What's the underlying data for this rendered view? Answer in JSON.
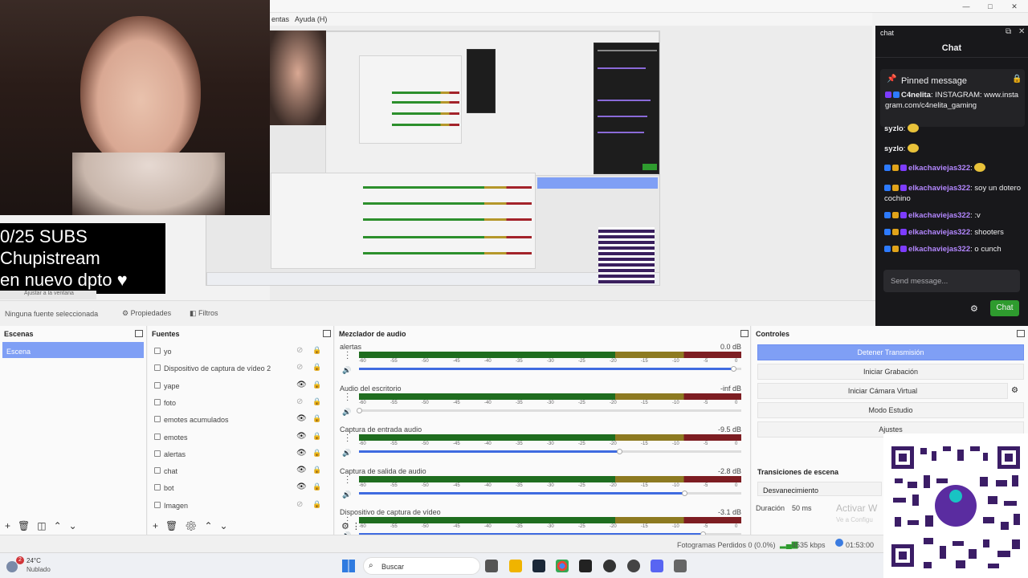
{
  "menu": {
    "item1": "entas",
    "item2": "Ayuda (H)"
  },
  "stream_overlay": {
    "line1": "0/25 SUBS",
    "line2": "Chupistream",
    "line3": "en nuevo dpto ♥"
  },
  "source_strip": {
    "no_source": "Ninguna fuente seleccionada",
    "properties": "Propiedades",
    "filters": "Filtros",
    "zoom": "Ajustar a la ventana"
  },
  "scenes": {
    "title": "Escenas",
    "items": [
      "Escena"
    ]
  },
  "sources": {
    "title": "Fuentes",
    "items": [
      {
        "label": "yo",
        "visible": false,
        "locked": false
      },
      {
        "label": "Dispositivo de captura de vídeo 2",
        "visible": false,
        "locked": false
      },
      {
        "label": "yape",
        "visible": true,
        "locked": false
      },
      {
        "label": "foto",
        "visible": false,
        "locked": false
      },
      {
        "label": "emotes acumulados",
        "visible": true,
        "locked": false
      },
      {
        "label": "emotes",
        "visible": true,
        "locked": false
      },
      {
        "label": "alertas",
        "visible": true,
        "locked": false
      },
      {
        "label": "chat",
        "visible": true,
        "locked": false
      },
      {
        "label": "bot",
        "visible": true,
        "locked": true
      },
      {
        "label": "Imagen",
        "visible": false,
        "locked": true
      }
    ]
  },
  "mixer": {
    "title": "Mezclador de audio",
    "ticks": [
      "-60",
      "-55",
      "-50",
      "-45",
      "-40",
      "-35",
      "-30",
      "-25",
      "-20",
      "-15",
      "-10",
      "-5",
      "0"
    ],
    "channels": [
      {
        "name": "alertas",
        "db": "0.0 dB",
        "volume": 0.98
      },
      {
        "name": "Audio del escritorio",
        "db": "-inf dB",
        "volume": 0.0
      },
      {
        "name": "Captura de entrada audio",
        "db": "-9.5 dB",
        "volume": 0.68
      },
      {
        "name": "Captura de salida de audio",
        "db": "-2.8 dB",
        "volume": 0.85
      },
      {
        "name": "Dispositivo de captura de vídeo",
        "db": "-3.1 dB",
        "volume": 0.9
      }
    ]
  },
  "controls": {
    "title": "Controles",
    "stop_stream": "Detener Transmisión",
    "start_rec": "Iniciar Grabación",
    "virtual_cam": "Iniciar Cámara Virtual",
    "studio": "Modo Estudio",
    "settings": "Ajustes"
  },
  "transitions": {
    "title": "Transiciones de escena",
    "selected": "Desvanecimiento",
    "duration_label": "Duración",
    "duration": "50 ms",
    "activate": "Activar W",
    "go_config": "Ve a Configu"
  },
  "chat": {
    "window_title": "chat",
    "header": "Chat",
    "pinned_label": "Pinned message",
    "pinned_user": "C4nelita",
    "pinned_text": "INSTAGRAM: www.instagram.com/c4nelita_gaming",
    "messages": [
      {
        "user": "syzlo",
        "text": ""
      },
      {
        "user": "syzlo",
        "text": ""
      },
      {
        "user": "elkachaviejas322",
        "text": ""
      },
      {
        "user": "elkachaviejas322",
        "text": "soy un dotero cochino"
      },
      {
        "user": "elkachaviejas322",
        "text": ":v"
      },
      {
        "user": "elkachaviejas322",
        "text": "shooters"
      },
      {
        "user": "elkachaviejas322",
        "text": "o cunch"
      }
    ],
    "placeholder": "Send message...",
    "send": "Chat"
  },
  "statusbar": {
    "dropped": "Fotogramas Perdidos 0 (0.0%)",
    "bitrate": "4535 kbps",
    "time": "01:53:00"
  },
  "taskbar": {
    "temp": "24°C",
    "weather": "Nublado",
    "search": "Buscar",
    "notif": "2"
  },
  "colors": {
    "accent": "#7f9ff5",
    "chat_bg": "#18181b",
    "chat_user": "#b387ff",
    "send_btn": "#2e9b2e"
  }
}
